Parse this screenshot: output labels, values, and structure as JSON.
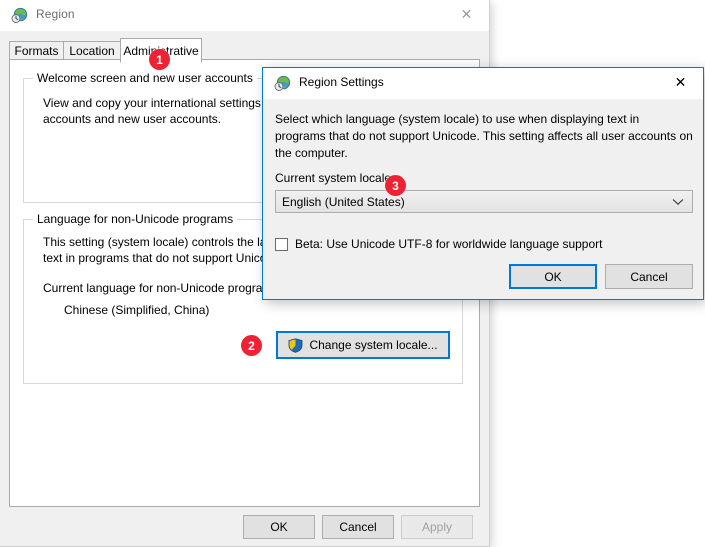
{
  "region_window": {
    "title": "Region",
    "title_icon": "region-globe-clock-icon",
    "close_icon": "close-icon",
    "tabs": [
      {
        "label": "Formats",
        "active": false
      },
      {
        "label": "Location",
        "active": false
      },
      {
        "label": "Administrative",
        "active": true
      }
    ],
    "welcome_group": {
      "title": "Welcome screen and new user accounts",
      "description_line1": "View and copy your international settings t",
      "description_line2": "accounts and new user accounts."
    },
    "language_group": {
      "title": "Language for non-Unicode programs",
      "description_line1": "This setting (system locale) controls the lan",
      "description_line2": "text in programs that do not support Unico",
      "current_label": "Current language for non-Unicode progran",
      "current_value": "Chinese (Simplified, China)",
      "change_button_label": "Change system locale...",
      "change_button_icon": "uac-shield-icon"
    },
    "footer": {
      "ok_label": "OK",
      "cancel_label": "Cancel",
      "apply_label": "Apply",
      "apply_disabled": true
    }
  },
  "settings_dialog": {
    "title": "Region Settings",
    "title_icon": "region-globe-clock-icon",
    "close_icon": "close-icon",
    "description": "Select which language (system locale) to use when displaying text in programs that do not support Unicode. This setting affects all user accounts on the computer.",
    "locale_label": "Current system locale:",
    "locale_value": "English (United States)",
    "locale_dropdown_icon": "chevron-down-icon",
    "utf8_checkbox_label": "Beta: Use Unicode UTF-8 for worldwide language support",
    "utf8_checked": false,
    "ok_label": "OK",
    "cancel_label": "Cancel"
  },
  "annotations": {
    "badge_1": "1",
    "badge_2": "2",
    "badge_3": "3"
  },
  "colors": {
    "accent": "#0078d7",
    "badge": "#ee2233",
    "window_face": "#f0f0f0",
    "button_face": "#e1e1e1"
  }
}
